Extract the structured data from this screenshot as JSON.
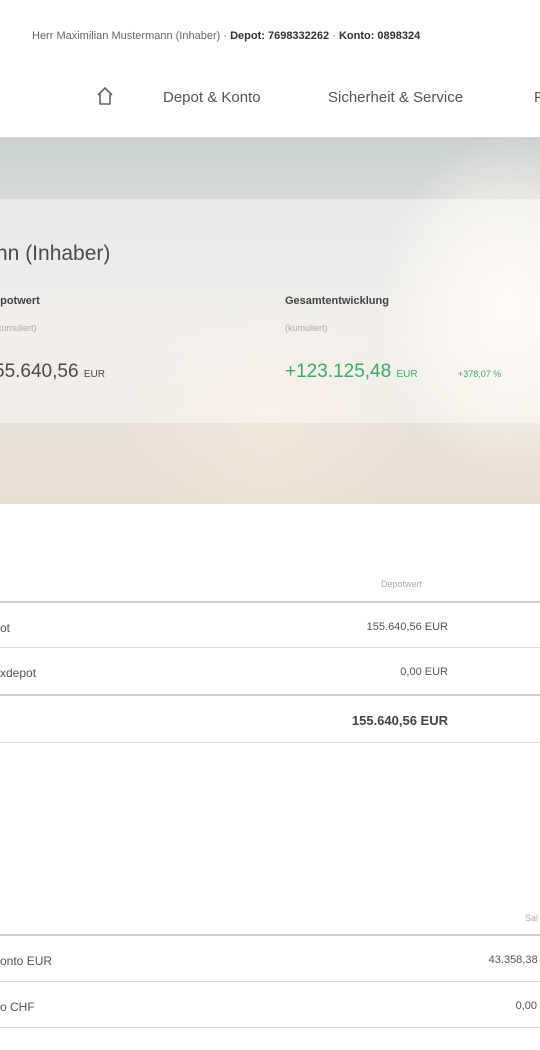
{
  "topbar": {
    "user": "Herr Maximilian Mustermann (Inhaber)",
    "sep1": "·",
    "depot": "Depot: 7698332262",
    "sep2": "·",
    "konto": "Konto: 0898324"
  },
  "nav": {
    "items": [
      {
        "label": "Depot & Konto"
      },
      {
        "label": "Sicherheit & Service"
      },
      {
        "label": "P"
      }
    ]
  },
  "hero": {
    "name": "nn (Inhaber)",
    "depotwert_label": "epotwert",
    "depotwert_sub": "(kumuliert)",
    "depotwert_value": "55.640,56",
    "depotwert_currency": "EUR",
    "gesamt_label": "Gesamtentwicklung",
    "gesamt_sub": "(kumuliert)",
    "gesamt_value": "+123.125,48",
    "gesamt_currency": "EUR",
    "gesamt_pct": "+378,07 %"
  },
  "depots": {
    "col_header": "Depotwert",
    "rows": [
      {
        "name": "ot",
        "value": "155.640,56 EUR"
      },
      {
        "name": "xdepot",
        "value": "0,00 EUR"
      }
    ],
    "total": "155.640,56 EUR"
  },
  "konten": {
    "col_header": "Sal",
    "rows": [
      {
        "name": "onto EUR",
        "value": "43.358,38 E"
      },
      {
        "name": "o CHF",
        "value": "0,00 C"
      }
    ]
  },
  "colors": {
    "positive": "#3aaa64",
    "text": "#4a4a4a"
  }
}
